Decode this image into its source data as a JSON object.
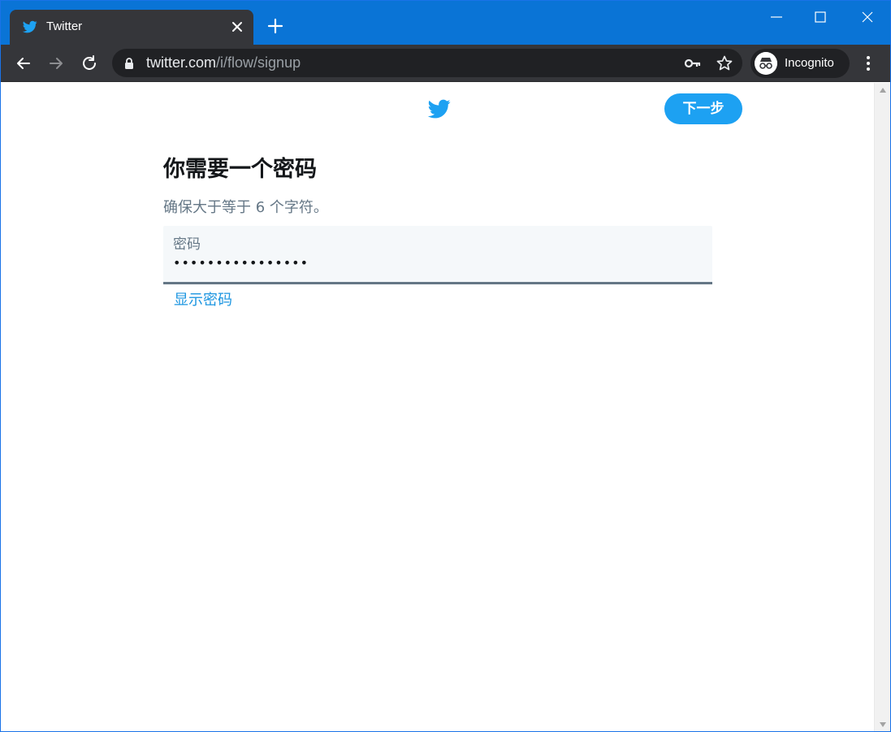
{
  "browser": {
    "tab": {
      "title": "Twitter"
    },
    "url": {
      "host": "twitter.com",
      "path": "/i/flow/signup"
    },
    "profile": {
      "label": "Incognito"
    }
  },
  "page": {
    "next_button": "下一步",
    "heading": "你需要一个密码",
    "subtext": "确保大于等于 6 个字符。",
    "password_field": {
      "label": "密码",
      "value": "••••••••••••••••"
    },
    "show_password": "显示密码"
  },
  "colors": {
    "brand": "#1da1f2",
    "titlebar": "#0a74d6",
    "toolbar": "#35363a",
    "link": "#1b95e0"
  },
  "icons": [
    "twitter-bird-icon",
    "close-icon",
    "plus-icon",
    "minimize-icon",
    "maximize-icon",
    "window-close-icon",
    "back-arrow-icon",
    "forward-arrow-icon",
    "reload-icon",
    "lock-icon",
    "key-icon",
    "star-icon",
    "incognito-icon",
    "kebab-menu-icon"
  ]
}
